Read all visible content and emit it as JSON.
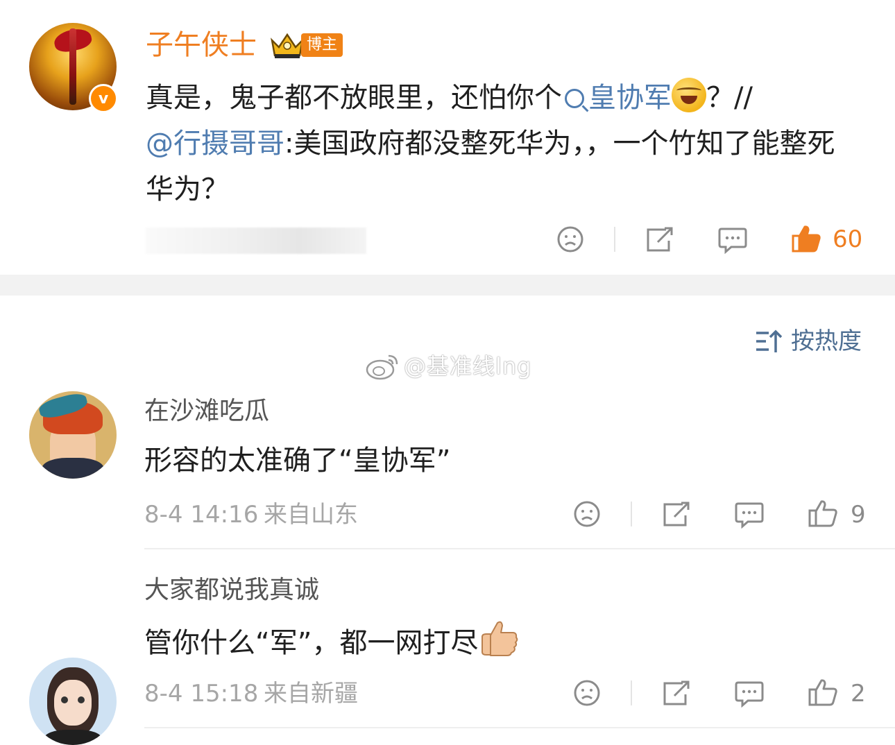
{
  "post": {
    "author": "子午侠士",
    "badge": "博主",
    "verified_mark": "v",
    "text_prefix": "真是，鬼子都不放眼里，还怕你个",
    "search_topic": "皇协军",
    "text_after_topic": "？//",
    "mention": "@行摄哥哥",
    "text_quote": ":美国政府都没整死华为，，一个竹知了能整死华为？",
    "like_count": "60",
    "accent_color": "#ef7e21",
    "link_color": "#4f7cb0"
  },
  "sort": {
    "label": "按热度",
    "icon": "sort-icon"
  },
  "watermark": "@基准线lng",
  "comments": [
    {
      "name": "在沙滩吃瓜",
      "text": "形容的太准确了“皇协军”",
      "time": "8-4 14:16",
      "location": "来自山东",
      "likes": "9"
    },
    {
      "name": "大家都说我真诚",
      "text": "管你什么“军”，都一网打尽",
      "time": "8-4 15:18",
      "location": "来自新疆",
      "likes": "2"
    }
  ]
}
